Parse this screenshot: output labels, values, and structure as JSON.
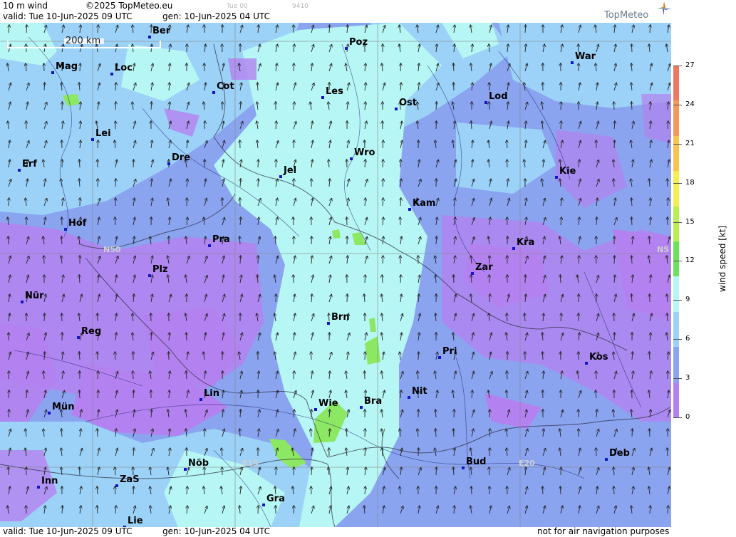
{
  "header": {
    "product": "10 m wind",
    "copyright": "©2025 TopMeteo.eu",
    "faint_time": "Tue 00",
    "faint_code": "9410",
    "valid": "valid:  Tue  10-Jun-2025  09 UTC",
    "gen": "gen: 10-Jun-2025 04 UTC",
    "logo": "TopMeteo"
  },
  "footer": {
    "valid": "valid:  Tue  10-Jun-2025  09 UTC",
    "gen": "gen: 10-Jun-2025 04 UTC",
    "disclaimer": "not for air navigation purposes"
  },
  "legend": {
    "unit": "wind  speed  [kt]",
    "ticks": [
      "27",
      "24",
      "21",
      "18",
      "15",
      "12",
      "9",
      "6",
      "3",
      "0"
    ],
    "colors": [
      "#f07860",
      "#f49a58",
      "#f8c450",
      "#f4ee50",
      "#b8ee50",
      "#6ae25a",
      "#b6f6f4",
      "#9cd2f8",
      "#8aa4f0",
      "#b482f0"
    ]
  },
  "map": {
    "scale_label": "200 km",
    "grid_labels": [
      "N50",
      "N5",
      "E15",
      "E20"
    ],
    "cities": [
      "Ber",
      "Poz",
      "War",
      "Mag",
      "Loc",
      "Cot",
      "Les",
      "Lod",
      "Ost",
      "Lei",
      "Erf",
      "Dre",
      "Wro",
      "Kie",
      "Jel",
      "Kam",
      "Hof",
      "Pra",
      "Kra",
      "Zar",
      "Plz",
      "Nür",
      "Brn",
      "Reg",
      "Pri",
      "Kos",
      "Lin",
      "Nit",
      "Mün",
      "Wie",
      "Bra",
      "Deb",
      "Nöb",
      "Bud",
      "Inn",
      "ZaS",
      "Gra",
      "Lie"
    ]
  }
}
